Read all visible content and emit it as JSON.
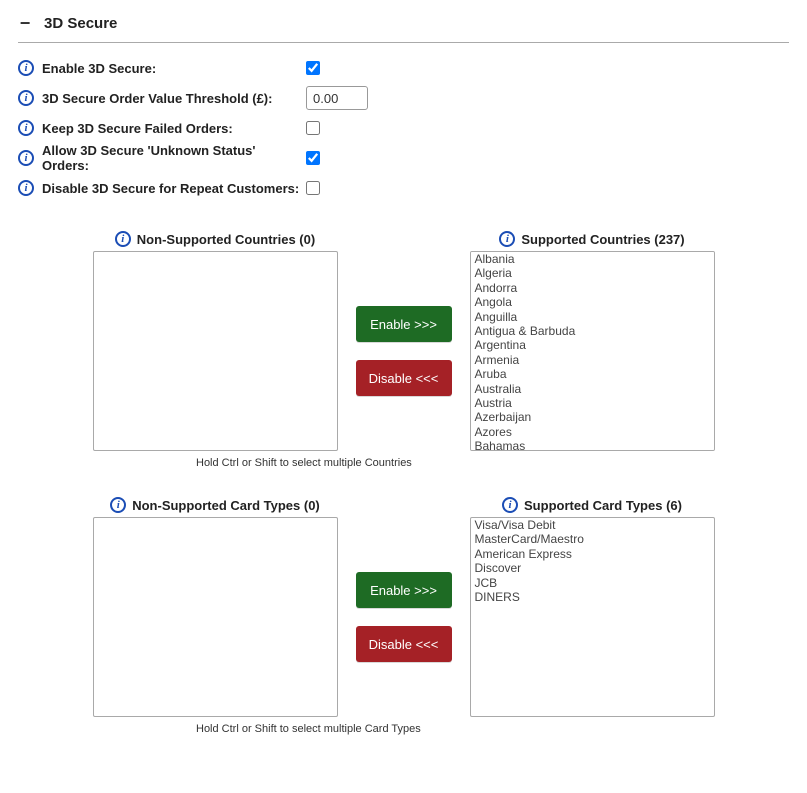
{
  "section": {
    "title": "3D Secure"
  },
  "form": {
    "enable": {
      "label": "Enable 3D Secure:",
      "checked": true
    },
    "threshold": {
      "label": "3D Secure Order Value Threshold (£):",
      "value": "0.00"
    },
    "keep_failed": {
      "label": "Keep 3D Secure Failed Orders:",
      "checked": false
    },
    "allow_unknown": {
      "label": "Allow 3D Secure 'Unknown Status' Orders:",
      "checked": true
    },
    "disable_repeat": {
      "label": "Disable 3D Secure for Repeat Customers:",
      "checked": false
    }
  },
  "countries": {
    "left_title": "Non-Supported Countries (0)",
    "right_title": "Supported Countries (237)",
    "left_items": [],
    "right_items": [
      "Albania",
      "Algeria",
      "Andorra",
      "Angola",
      "Anguilla",
      "Antigua & Barbuda",
      "Argentina",
      "Armenia",
      "Aruba",
      "Australia",
      "Austria",
      "Azerbaijan",
      "Azores",
      "Bahamas"
    ],
    "enable_btn": "Enable >>>",
    "disable_btn": "Disable <<<",
    "hint": "Hold Ctrl or Shift to select multiple Countries"
  },
  "cardtypes": {
    "left_title": "Non-Supported Card Types (0)",
    "right_title": "Supported Card Types (6)",
    "left_items": [],
    "right_items": [
      "Visa/Visa Debit",
      "MasterCard/Maestro",
      "American Express",
      "Discover",
      "JCB",
      "DINERS"
    ],
    "enable_btn": "Enable >>>",
    "disable_btn": "Disable <<<",
    "hint": "Hold Ctrl or Shift to select multiple Card Types"
  }
}
